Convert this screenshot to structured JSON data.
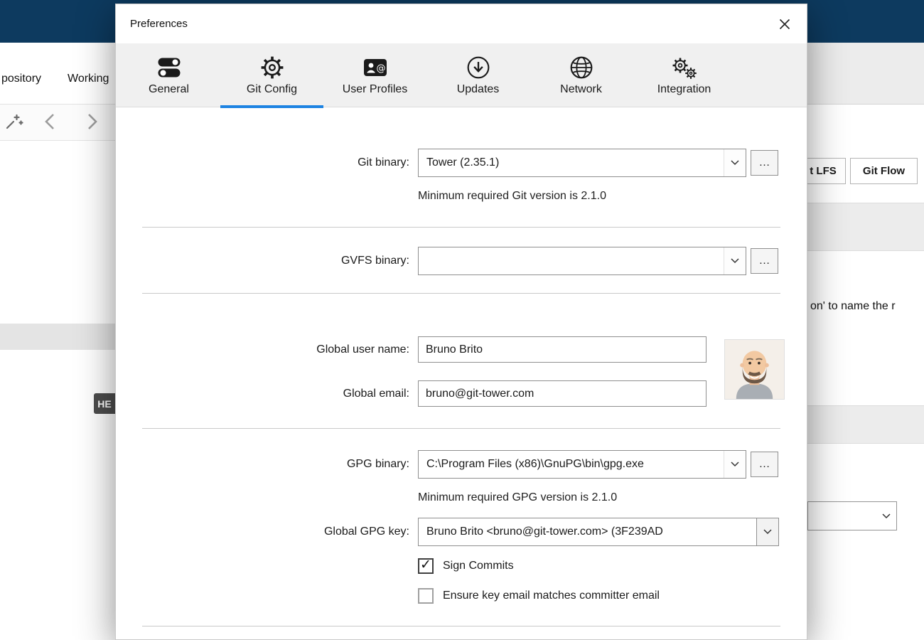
{
  "colors": {
    "title_bar_navy": "#0d3a5f",
    "accent_blue": "#1d83e2",
    "tab_strip_gray": "#f0f0f0"
  },
  "background": {
    "menu_items": [
      {
        "label": "pository"
      },
      {
        "label": "Working"
      }
    ],
    "right_buttons": [
      {
        "label": "t LFS"
      },
      {
        "label": "Git Flow"
      }
    ],
    "text_snippet": "on' to name the r",
    "head_badge": "HE"
  },
  "dialog": {
    "title": "Preferences",
    "tabs": [
      {
        "label": "General"
      },
      {
        "label": "Git Config",
        "selected": true
      },
      {
        "label": "User Profiles"
      },
      {
        "label": "Updates"
      },
      {
        "label": "Network"
      },
      {
        "label": "Integration"
      }
    ],
    "git_binary": {
      "label": "Git binary:",
      "value": "Tower (2.35.1)",
      "help": "Minimum required Git version is 2.1.0"
    },
    "gvfs_binary": {
      "label": "GVFS binary:",
      "value": ""
    },
    "global_user_name": {
      "label": "Global user name:",
      "value": "Bruno Brito"
    },
    "global_email": {
      "label": "Global email:",
      "value": "bruno@git-tower.com"
    },
    "gpg_binary": {
      "label": "GPG binary:",
      "value": "C:\\Program Files (x86)\\GnuPG\\bin\\gpg.exe",
      "help": "Minimum required GPG version is 2.1.0"
    },
    "global_gpg_key": {
      "label": "Global GPG key:",
      "value": "Bruno Brito <bruno@git-tower.com> (3F239AD"
    },
    "sign_commits": {
      "label": "Sign Commits",
      "checked": true
    },
    "ensure_key_email": {
      "label": "Ensure key email matches committer email",
      "checked": false
    },
    "more_button": "…"
  }
}
